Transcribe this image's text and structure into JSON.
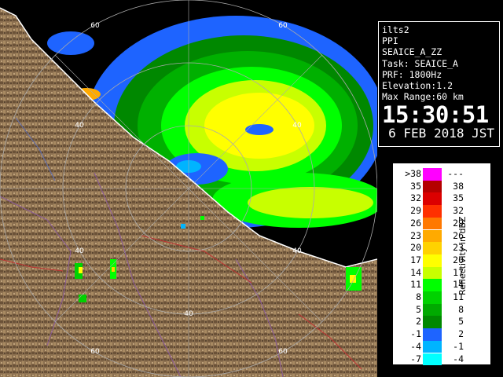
{
  "info_panel": {
    "station": "ilts2",
    "mode": "PPI",
    "product": "SEAICE_A_ZZ",
    "task": "Task: SEAICE_A",
    "prf": "PRF: 1800Hz",
    "elevation": "Elevation:1.2",
    "max_range": "Max Range:60 km",
    "time": "15:30:51",
    "date": "6 FEB 2018 JST"
  },
  "range_labels": [
    "60",
    "40",
    "40",
    "40",
    "60",
    "40",
    "40",
    "60",
    "60"
  ],
  "legend": {
    "title": "Reflectivity in dBZ",
    "rows": [
      {
        "low": ">38",
        "high": "---",
        "color": "#ff00ff"
      },
      {
        "low": "35",
        "high": "38",
        "color": "#b40000"
      },
      {
        "low": "32",
        "high": "35",
        "color": "#dc0000"
      },
      {
        "low": "29",
        "high": "32",
        "color": "#ff3000"
      },
      {
        "low": "26",
        "high": "29",
        "color": "#ff7800"
      },
      {
        "low": "23",
        "high": "26",
        "color": "#ffaa00"
      },
      {
        "low": "20",
        "high": "23",
        "color": "#ffd200"
      },
      {
        "low": "17",
        "high": "20",
        "color": "#ffff00"
      },
      {
        "low": "14",
        "high": "17",
        "color": "#c8ff00"
      },
      {
        "low": "11",
        "high": "14",
        "color": "#00ff00"
      },
      {
        "low": "8",
        "high": "11",
        "color": "#00d200"
      },
      {
        "low": "5",
        "high": "8",
        "color": "#00aa00"
      },
      {
        "low": "2",
        "high": "5",
        "color": "#008800"
      },
      {
        "low": "-1",
        "high": "2",
        "color": "#1e64ff"
      },
      {
        "low": "-4",
        "high": "-1",
        "color": "#00b4ff"
      },
      {
        "low": "-7",
        "high": "-4",
        "color": "#00ffff"
      }
    ]
  },
  "colors": {
    "sea": "#000000",
    "land": "#8c7050",
    "land_dark": "#5a4530",
    "coast": "#ffffff",
    "rings": "#aaaaaa"
  }
}
